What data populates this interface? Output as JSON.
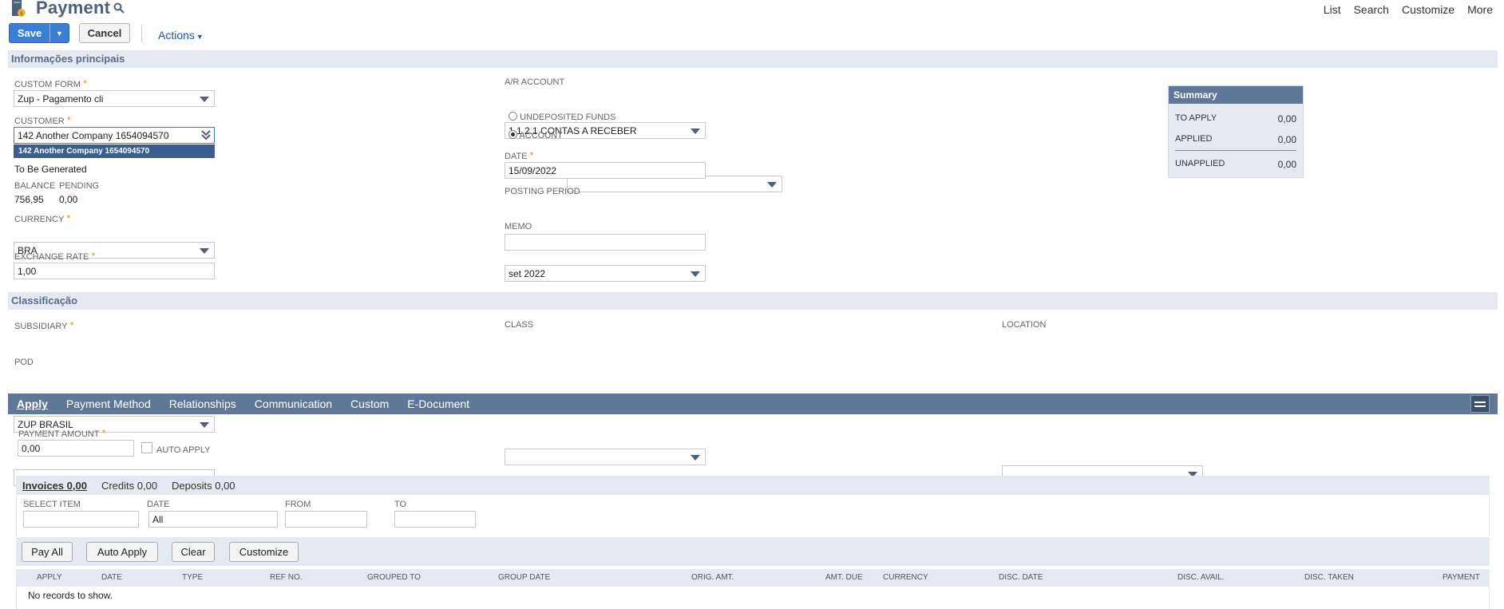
{
  "header": {
    "title": "Payment",
    "links": [
      "List",
      "Search",
      "Customize",
      "More"
    ]
  },
  "toolbar": {
    "save_label": "Save",
    "cancel_label": "Cancel",
    "actions_label": "Actions"
  },
  "main_section": {
    "title": "Informações principais",
    "custom_form": {
      "label": "CUSTOM FORM",
      "value": "Zup - Pagamento cli"
    },
    "customer": {
      "label": "CUSTOMER",
      "value": "142 Another Company 1654094570",
      "dropdown_option": "142 Another Company 1654094570"
    },
    "number_text": "To Be Generated",
    "balance": {
      "label": "BALANCE",
      "value": "756,95"
    },
    "pending": {
      "label": "PENDING",
      "value": "0,00"
    },
    "currency": {
      "label": "CURRENCY",
      "value": "BRA"
    },
    "exchange_rate": {
      "label": "EXCHANGE RATE",
      "value": "1,00"
    },
    "ar_account": {
      "label": "A/R ACCOUNT",
      "value": "1.1.2.1 CONTAS A RECEBER"
    },
    "undeposited_funds": {
      "label": "UNDEPOSITED FUNDS",
      "selected": false
    },
    "account": {
      "label": "ACCOUNT",
      "selected": true,
      "value": ""
    },
    "date": {
      "label": "DATE",
      "value": "15/09/2022"
    },
    "posting_period": {
      "label": "POSTING PERIOD",
      "value": "set 2022"
    },
    "memo": {
      "label": "MEMO",
      "value": ""
    }
  },
  "summary": {
    "title": "Summary",
    "to_apply": {
      "label": "TO APPLY",
      "value": "0,00"
    },
    "applied": {
      "label": "APPLIED",
      "value": "0,00"
    },
    "unapplied": {
      "label": "UNAPPLIED",
      "value": "0,00"
    }
  },
  "classification": {
    "title": "Classificação",
    "subsidiary": {
      "label": "SUBSIDIARY",
      "value": "ZUP BRASIL"
    },
    "pod": {
      "label": "POD",
      "value": ""
    },
    "class": {
      "label": "CLASS",
      "value": ""
    },
    "location": {
      "label": "LOCATION",
      "value": ""
    }
  },
  "tabs": [
    {
      "label": "Apply",
      "active": true
    },
    {
      "label": "Payment Method",
      "active": false
    },
    {
      "label": "Relationships",
      "active": false
    },
    {
      "label": "Communication",
      "active": false
    },
    {
      "label": "Custom",
      "active": false
    },
    {
      "label": "E-Document",
      "active": false
    }
  ],
  "apply": {
    "payment_amount": {
      "label": "PAYMENT AMOUNT",
      "value": "0,00"
    },
    "auto_apply_label": "AUTO APPLY",
    "subtabs": [
      "Invoices 0,00",
      "Credits 0,00",
      "Deposits 0,00"
    ],
    "filters": {
      "select_item": {
        "label": "SELECT ITEM",
        "value": ""
      },
      "date": {
        "label": "DATE",
        "value": "All"
      },
      "from": {
        "label": "FROM",
        "value": ""
      },
      "to": {
        "label": "TO",
        "value": ""
      }
    },
    "buttons": [
      "Pay All",
      "Auto Apply",
      "Clear",
      "Customize"
    ],
    "columns": [
      "APPLY",
      "DATE",
      "TYPE",
      "REF NO.",
      "GROUPED TO",
      "GROUP DATE",
      "ORIG. AMT.",
      "AMT. DUE",
      "CURRENCY",
      "DISC. DATE",
      "DISC. AVAIL.",
      "DISC. TAKEN",
      "PAYMENT"
    ],
    "empty_text": "No records to show."
  },
  "colors": {
    "accent": "#3a7fd6",
    "section_bg": "#e5eaf2",
    "tab_bar": "#607799",
    "title": "#4d5f79",
    "required": "#e88f1e"
  }
}
